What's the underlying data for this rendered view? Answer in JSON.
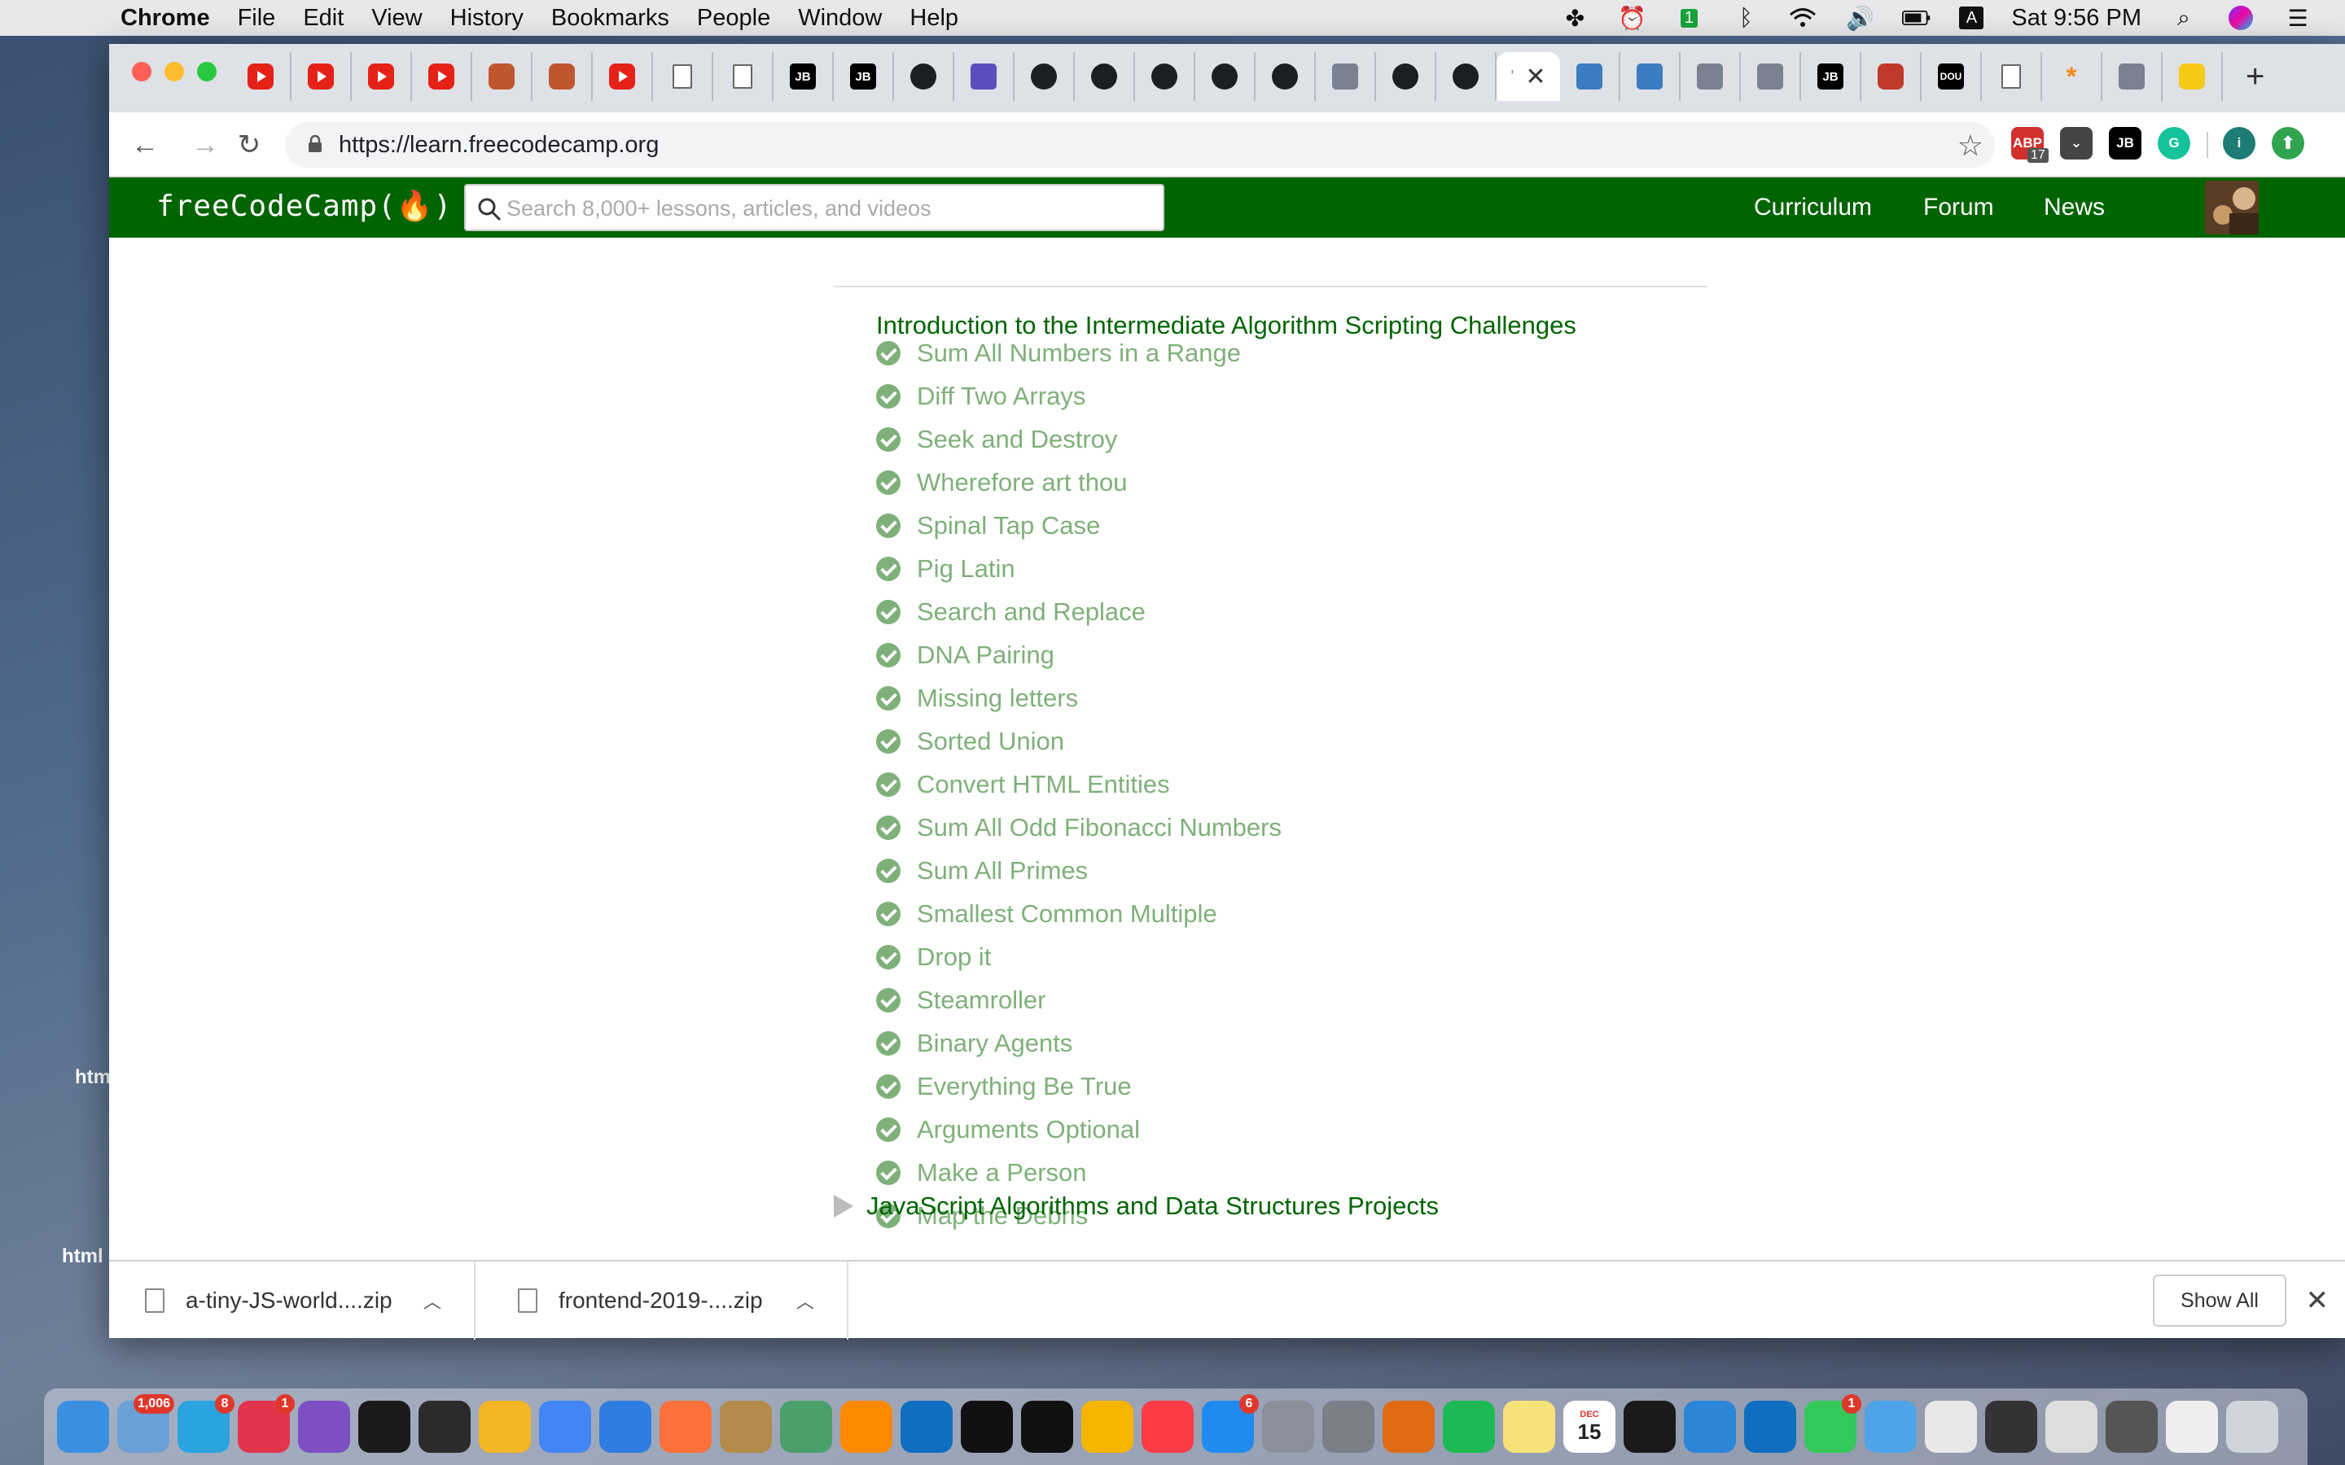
{
  "menubar": {
    "items": [
      "Chrome",
      "File",
      "Edit",
      "View",
      "History",
      "Bookmarks",
      "People",
      "Window",
      "Help"
    ],
    "status_count": "1",
    "clock": "Sat 9:56 PM"
  },
  "desktop": {
    "label_1": "htm",
    "label_2": "html"
  },
  "browser": {
    "active_tab_label": "'",
    "tab_favicons": [
      "youtube",
      "youtube",
      "youtube",
      "youtube",
      "avatar",
      "avatar",
      "youtube",
      "file",
      "file",
      "jetbrains",
      "jetbrains",
      "github",
      "list",
      "github",
      "github",
      "github",
      "github",
      "github",
      "bug",
      "github",
      "github",
      "active",
      "bird",
      "bird",
      "lightning",
      "shield",
      "jetbrains",
      "redbox",
      "dou",
      "file",
      "asterisk",
      "spiral",
      "coin"
    ],
    "url": "https://learn.freecodecamp.org",
    "extensions": {
      "adblock_badge": "17",
      "info_label": "i"
    }
  },
  "site": {
    "logo": "freeCodeCamp(🔥)",
    "search_placeholder": "Search 8,000+ lessons, articles, and videos",
    "nav": [
      "Curriculum",
      "Forum",
      "News"
    ],
    "section_title": "Introduction to the Intermediate Algorithm Scripting Challenges",
    "challenges": [
      "Sum All Numbers in a Range",
      "Diff Two Arrays",
      "Seek and Destroy",
      "Wherefore art thou",
      "Spinal Tap Case",
      "Pig Latin",
      "Search and Replace",
      "DNA Pairing",
      "Missing letters",
      "Sorted Union",
      "Convert HTML Entities",
      "Sum All Odd Fibonacci Numbers",
      "Sum All Primes",
      "Smallest Common Multiple",
      "Drop it",
      "Steamroller",
      "Binary Agents",
      "Everything Be True",
      "Arguments Optional",
      "Make a Person",
      "Map the Debris"
    ],
    "next_section": "JavaScript Algorithms and Data Structures Projects"
  },
  "downloads": {
    "items": [
      "a-tiny-JS-world....zip",
      "frontend-2019-....zip"
    ],
    "show_all": "Show All"
  },
  "dock": {
    "badges": {
      "mail": "1,006",
      "telegram": "8",
      "other": "1",
      "facetime": "1",
      "appstore": "6"
    },
    "calendar_day": "15",
    "calendar_month": "DEC"
  },
  "colors": {
    "fcc_green": "#006400",
    "completed_green": "#7fb07a",
    "tab_strip": "#dee1e6"
  }
}
